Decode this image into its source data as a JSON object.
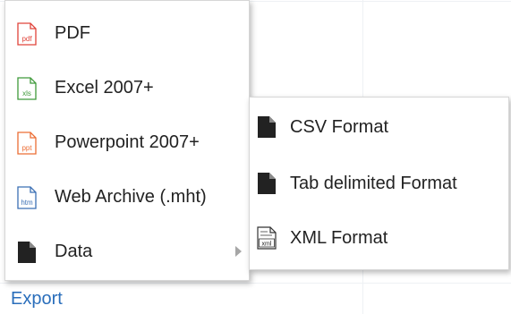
{
  "menu": {
    "items": [
      {
        "label": "PDF",
        "icon": "pdf-file-icon",
        "icon_text": "pdf",
        "color": "#e0433a"
      },
      {
        "label": "Excel 2007+",
        "icon": "excel-file-icon",
        "icon_text": "xls",
        "color": "#3f9a3a"
      },
      {
        "label": "Powerpoint 2007+",
        "icon": "powerpoint-file-icon",
        "icon_text": "ppt",
        "color": "#ec6d34"
      },
      {
        "label": "Web Archive (.mht)",
        "icon": "web-archive-file-icon",
        "icon_text": "htm",
        "color": "#3b6fb4"
      },
      {
        "label": "Data",
        "icon": "data-file-icon",
        "has_submenu": true
      }
    ]
  },
  "submenu": {
    "items": [
      {
        "label": "CSV Format",
        "icon": "csv-file-icon"
      },
      {
        "label": "Tab delimited Format",
        "icon": "tab-delimited-file-icon"
      },
      {
        "label": "XML Format",
        "icon": "xml-file-icon",
        "icon_text": "xml"
      }
    ]
  },
  "footer": {
    "export_label": "Export",
    "link_color": "#2a6ebb"
  }
}
